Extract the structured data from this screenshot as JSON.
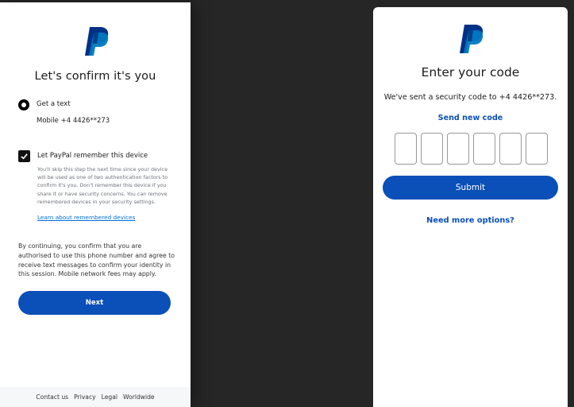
{
  "colors": {
    "brand_blue": "#0b4fb8",
    "link_blue": "#0070e0",
    "background": "#262626"
  },
  "left": {
    "title": "Let's confirm it's you",
    "option": {
      "label": "Get a text",
      "mobile": "Mobile  +4 4426**273"
    },
    "remember": {
      "label": "Let PayPal remember this device",
      "checked": true,
      "description": "You'll skip this step the next time since your device will be used as one of two authentication factors to confirm it's you. Don't remember this device if you share it or have security concerns. You can remove remembered devices in your security settings.",
      "link": "Learn about remembered devices"
    },
    "consent": "By continuing, you confirm that you are authorised to use this phone number and agree to receive text messages to confirm your identity in this session. Mobile network fees may apply.",
    "next_button": "Next",
    "footer": {
      "contact": "Contact us",
      "privacy": "Privacy",
      "legal": "Legal",
      "worldwide": "Worldwide"
    }
  },
  "right": {
    "title": "Enter your code",
    "sent_message": "We've sent a security code to +4 4426**273.",
    "send_new": "Send new code",
    "code_digits": [
      "",
      "",
      "",
      "",
      "",
      ""
    ],
    "submit_button": "Submit",
    "more_options": "Need more options?"
  }
}
